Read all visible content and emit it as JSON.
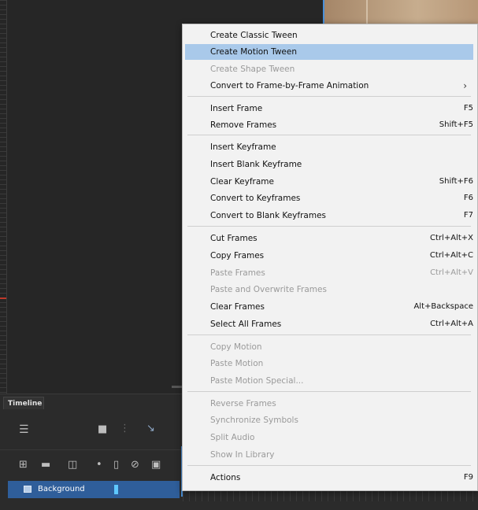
{
  "timeline": {
    "tab_label": "Timeline",
    "layer_name": "Background"
  },
  "context_menu": {
    "items": [
      {
        "label": "Create Classic Tween",
        "shortcut": "",
        "enabled": true
      },
      {
        "label": "Create Motion Tween",
        "shortcut": "",
        "enabled": true,
        "highlighted": true
      },
      {
        "label": "Create Shape Tween",
        "shortcut": "",
        "enabled": false
      },
      {
        "label": "Convert to Frame-by-Frame Animation",
        "shortcut": "",
        "enabled": true,
        "submenu_arrow": "›"
      },
      {
        "label": "Insert Frame",
        "shortcut": "F5",
        "enabled": true
      },
      {
        "label": "Remove Frames",
        "shortcut": "Shift+F5",
        "enabled": true
      },
      {
        "label": "Insert Keyframe",
        "shortcut": "",
        "enabled": true
      },
      {
        "label": "Insert Blank Keyframe",
        "shortcut": "",
        "enabled": true
      },
      {
        "label": "Clear Keyframe",
        "shortcut": "Shift+F6",
        "enabled": true
      },
      {
        "label": "Convert to Keyframes",
        "shortcut": "F6",
        "enabled": true
      },
      {
        "label": "Convert to Blank Keyframes",
        "shortcut": "F7",
        "enabled": true
      },
      {
        "label": "Cut Frames",
        "shortcut": "Ctrl+Alt+X",
        "enabled": true
      },
      {
        "label": "Copy Frames",
        "shortcut": "Ctrl+Alt+C",
        "enabled": true
      },
      {
        "label": "Paste Frames",
        "shortcut": "Ctrl+Alt+V",
        "enabled": false
      },
      {
        "label": "Paste and Overwrite Frames",
        "shortcut": "",
        "enabled": false
      },
      {
        "label": "Clear Frames",
        "shortcut": "Alt+Backspace",
        "enabled": true
      },
      {
        "label": "Select All Frames",
        "shortcut": "Ctrl+Alt+A",
        "enabled": true
      },
      {
        "label": "Copy Motion",
        "shortcut": "",
        "enabled": false
      },
      {
        "label": "Paste Motion",
        "shortcut": "",
        "enabled": false
      },
      {
        "label": "Paste Motion Special...",
        "shortcut": "",
        "enabled": false
      },
      {
        "label": "Reverse Frames",
        "shortcut": "",
        "enabled": false
      },
      {
        "label": "Synchronize Symbols",
        "shortcut": "",
        "enabled": false
      },
      {
        "label": "Split Audio",
        "shortcut": "",
        "enabled": false
      },
      {
        "label": "Show In Library",
        "shortcut": "",
        "enabled": false
      },
      {
        "label": "Actions",
        "shortcut": "F9",
        "enabled": true
      }
    ]
  },
  "icons": {
    "layers": "layers-icon",
    "camera": "camera-icon",
    "parent": "layer-parenting-icon",
    "graph": "graph-icon",
    "new_layer": "new-layer-icon",
    "folder": "new-folder-icon",
    "delete": "delete-icon",
    "dot": "highlight-dot-icon",
    "outline": "outline-icon",
    "hide": "hide-icon",
    "lock": "lock-icon"
  },
  "colors": {
    "menu_bg": "#f2f2f2",
    "menu_highlight": "#a9c9ea",
    "layer_selected": "#2f5e9a"
  }
}
